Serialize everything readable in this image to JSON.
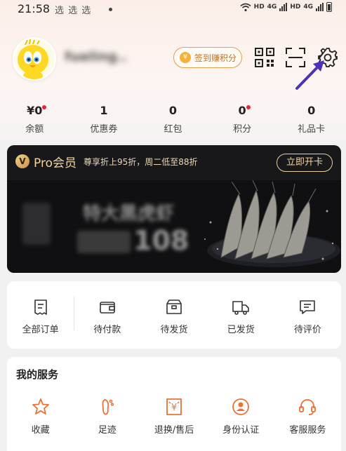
{
  "status_bar": {
    "time": "21:58",
    "notifications": "选 选 选",
    "net1": "HD",
    "net2": "4G",
    "net3": "HD",
    "net4": "4G"
  },
  "profile": {
    "username": "fueling..",
    "sign_in_button": "签到赚积分",
    "coin_symbol": "¥"
  },
  "stats": [
    {
      "value": "¥0",
      "label": "余额",
      "dot": true
    },
    {
      "value": "1",
      "label": "优惠券",
      "dot": false
    },
    {
      "value": "0",
      "label": "红包",
      "dot": false
    },
    {
      "value": "0",
      "label": "积分",
      "dot": true
    },
    {
      "value": "0",
      "label": "礼品卡",
      "dot": false
    }
  ],
  "pro": {
    "badge": "V",
    "title": "Pro会员",
    "subtitle": "尊享折上95折，周二低至88折",
    "button": "立即开卡",
    "promo_title": "特大黑虎虾",
    "promo_price": "108"
  },
  "orders": [
    {
      "label": "全部订单",
      "icon": "order-list-icon"
    },
    {
      "label": "待付款",
      "icon": "wallet-icon"
    },
    {
      "label": "待发货",
      "icon": "package-icon"
    },
    {
      "label": "已发货",
      "icon": "truck-icon"
    },
    {
      "label": "待评价",
      "icon": "comment-icon"
    }
  ],
  "services": {
    "title": "我的服务",
    "items": [
      {
        "label": "收藏",
        "icon": "star-icon"
      },
      {
        "label": "足迹",
        "icon": "footprint-icon"
      },
      {
        "label": "退换/售后",
        "icon": "refund-icon"
      },
      {
        "label": "身份认证",
        "icon": "id-verify-icon"
      },
      {
        "label": "客服服务",
        "icon": "headset-icon"
      }
    ]
  },
  "colors": {
    "accent_orange": "#e8723a",
    "pro_gold": "#f2d5a0",
    "alert_red": "#e6243a",
    "annotation_arrow": "#4a33b8"
  }
}
